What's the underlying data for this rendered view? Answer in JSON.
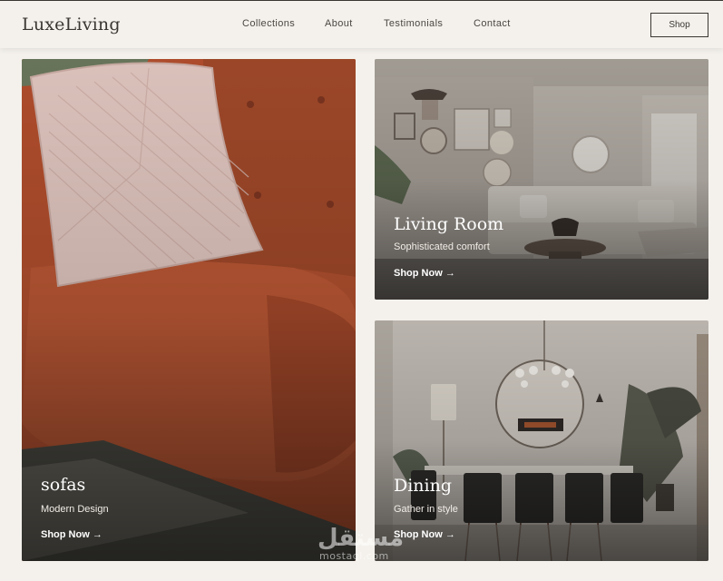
{
  "header": {
    "logo": "LuxeLiving",
    "nav": [
      "Collections",
      "About",
      "Testimonials",
      "Contact"
    ],
    "shop_label": "Shop"
  },
  "cards": {
    "sofas": {
      "title": "sofas",
      "subtitle": "Modern Design",
      "cta": "Shop Now →"
    },
    "living_room": {
      "title": "Living Room",
      "subtitle": "Sophisticated comfort",
      "cta": "Shop Now →"
    },
    "dining": {
      "title": "Dining",
      "subtitle": "Gather in style",
      "cta": "Shop Now →"
    }
  },
  "watermark": {
    "main": "مستقل",
    "sub": "mostaql.com"
  },
  "colors": {
    "background": "#f4f1ec",
    "text": "#3a3632",
    "sofa": "#b9532f"
  }
}
